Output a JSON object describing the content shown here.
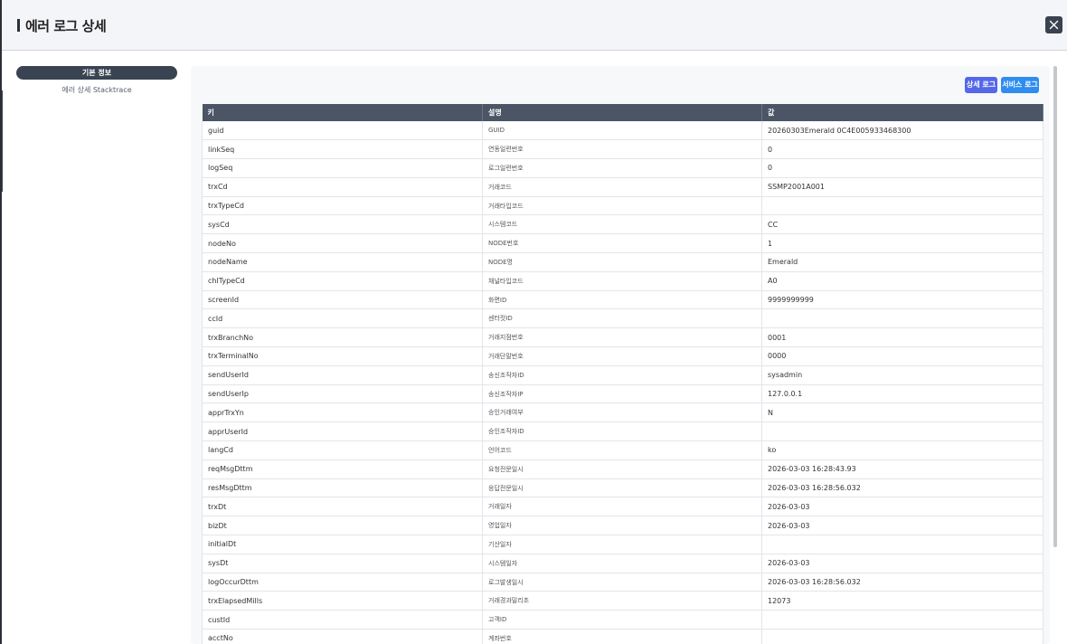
{
  "header": {
    "title": "에러 로그 상세"
  },
  "sidebar": {
    "active": "기본 정보",
    "item": "에러 상세 Stacktrace"
  },
  "actions": {
    "detail_log": "상세 로그",
    "service_log": "서비스 로그"
  },
  "table": {
    "headers": [
      "키",
      "설명",
      "값"
    ],
    "rows": [
      [
        "guid",
        "GUID",
        "20260303Emerald 0C4E005933468300"
      ],
      [
        "linkSeq",
        "연동일련번호",
        "0"
      ],
      [
        "logSeq",
        "로그일련번호",
        "0"
      ],
      [
        "trxCd",
        "거래코드",
        "SSMP2001A001"
      ],
      [
        "trxTypeCd",
        "거래타입코드",
        ""
      ],
      [
        "sysCd",
        "시스템코드",
        "CC"
      ],
      [
        "nodeNo",
        "NODE번호",
        "1"
      ],
      [
        "nodeName",
        "NODE명",
        "Emerald"
      ],
      [
        "chlTypeCd",
        "채널타입코드",
        "A0"
      ],
      [
        "screenId",
        "화면ID",
        "9999999999"
      ],
      [
        "ccId",
        "센터컷ID",
        ""
      ],
      [
        "trxBranchNo",
        "거래지점번호",
        "0001"
      ],
      [
        "trxTerminalNo",
        "거래단말번호",
        "0000"
      ],
      [
        "sendUserId",
        "송신조작자ID",
        "sysadmin"
      ],
      [
        "sendUserIp",
        "송신조작자IP",
        "127.0.0.1"
      ],
      [
        "apprTrxYn",
        "승인거래여부",
        "N"
      ],
      [
        "apprUserId",
        "승인조작자ID",
        ""
      ],
      [
        "langCd",
        "언어코드",
        "ko"
      ],
      [
        "reqMsgDttm",
        "요청전문일시",
        "2026-03-03 16:28:43.93"
      ],
      [
        "resMsgDttm",
        "응답전문일시",
        "2026-03-03 16:28:56.032"
      ],
      [
        "trxDt",
        "거래일자",
        "2026-03-03"
      ],
      [
        "bizDt",
        "영업일자",
        "2026-03-03"
      ],
      [
        "initialDt",
        "기산일자",
        ""
      ],
      [
        "sysDt",
        "시스템일자",
        "2026-03-03"
      ],
      [
        "logOccurDttm",
        "로그발생일시",
        "2026-03-03 16:28:56.032"
      ],
      [
        "trxElapsedMills",
        "거래경과밀리초",
        "12073"
      ],
      [
        "custId",
        "고객ID",
        ""
      ],
      [
        "acctNo",
        "계좌번호",
        ""
      ]
    ]
  }
}
